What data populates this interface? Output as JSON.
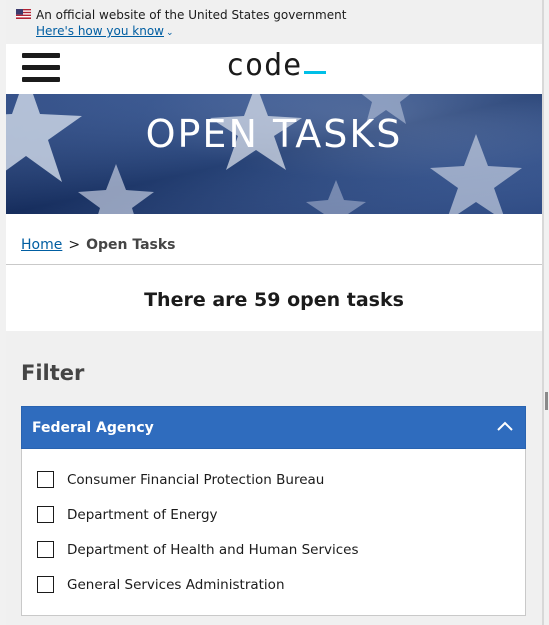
{
  "gov_banner": {
    "official_text": "An official website of the United States government",
    "how_you_know": "Here's how you know",
    "flag_icon": "us-flag-icon"
  },
  "header": {
    "logo_text": "code",
    "menu_icon": "hamburger-menu-icon"
  },
  "hero": {
    "title": "OPEN TASKS"
  },
  "breadcrumb": {
    "home": "Home",
    "separator": ">",
    "current": "Open Tasks"
  },
  "summary": {
    "count_text": "There are 59 open tasks"
  },
  "filter": {
    "title": "Filter",
    "accordion": {
      "label": "Federal Agency",
      "state": "expanded",
      "header_color": "#2f6cbe",
      "options": [
        {
          "label": "Consumer Financial Protection Bureau",
          "checked": false
        },
        {
          "label": "Department of Energy",
          "checked": false
        },
        {
          "label": "Department of Health and Human Services",
          "checked": false
        },
        {
          "label": "General Services Administration",
          "checked": false
        }
      ]
    }
  },
  "colors": {
    "link": "#005ea2",
    "accent_cursor": "#00bfe7",
    "hero_bg": "#2e4f8e"
  }
}
